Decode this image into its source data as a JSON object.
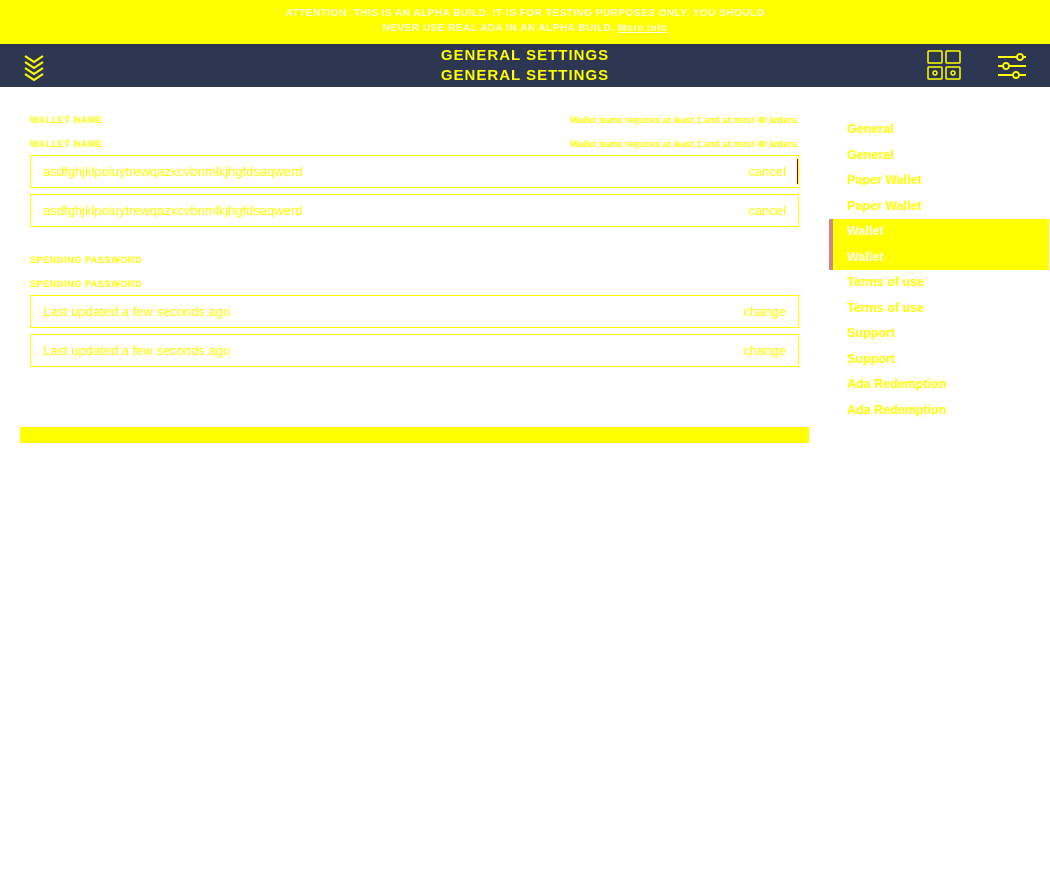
{
  "banner": {
    "line1": "ATTENTION: THIS IS AN ALPHA BUILD. IT IS FOR TESTING PURPOSES ONLY. YOU SHOULD",
    "line2_prefix": "NEVER USE REAL ADA IN AN ALPHA BUILD. ",
    "line2_link": "More info"
  },
  "header": {
    "title1": "GENERAL SETTINGS",
    "title2": "GENERAL SETTINGS"
  },
  "walletName": {
    "label": "WALLET NAME",
    "hint": "Wallet name requires at least 1 and at most 40 letters.",
    "value": "asdfghjklpoiuytrewqazxcvbnmlkjhgfdsaqwerd",
    "action": "cancel"
  },
  "spendingPassword": {
    "label": "SPENDING PASSWORD",
    "value": "Last updated a few seconds ago",
    "action": "change"
  },
  "sidebar": {
    "items": [
      {
        "label": "General"
      },
      {
        "label": "General"
      },
      {
        "label": "Paper Wallet"
      },
      {
        "label": "Paper Wallet"
      },
      {
        "label": "Wallet",
        "selected": true
      },
      {
        "label": "Wallet",
        "selected": true
      },
      {
        "label": "Terms of use"
      },
      {
        "label": "Terms of use"
      },
      {
        "label": "Support"
      },
      {
        "label": "Support"
      },
      {
        "label": "Ada Redemption"
      },
      {
        "label": "Ada Redemption"
      }
    ]
  }
}
